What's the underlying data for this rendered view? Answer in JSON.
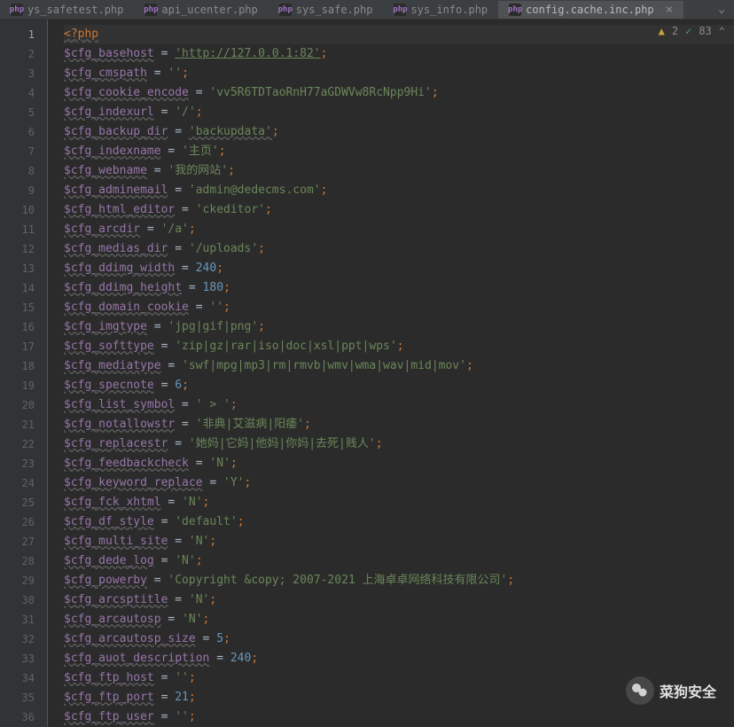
{
  "tabs": [
    {
      "label": "ys_safetest.php",
      "active": false
    },
    {
      "label": "api_ucenter.php",
      "active": false
    },
    {
      "label": "sys_safe.php",
      "active": false
    },
    {
      "label": "sys_info.php",
      "active": false
    },
    {
      "label": "config.cache.inc.php",
      "active": true
    }
  ],
  "status": {
    "warnings": "2",
    "checks": "83"
  },
  "watermark": "菜狗安全",
  "code": {
    "l1": {
      "t": "<?php"
    },
    "l2": {
      "v": "$cfg_basehost",
      "s": "'http://127.0.0.1:82'"
    },
    "l3": {
      "v": "$cfg_cmspath",
      "s": "''"
    },
    "l4": {
      "v": "$cfg_cookie_encode",
      "s": "'vv5R6TDTaoRnH77aGDWVw8RcNpp9Hi'"
    },
    "l5": {
      "v": "$cfg_indexurl",
      "s": "'/'"
    },
    "l6": {
      "v": "$cfg_backup_dir",
      "s": "'backupdata'"
    },
    "l7": {
      "v": "$cfg_indexname",
      "s": "'主页'"
    },
    "l8": {
      "v": "$cfg_webname",
      "s": "'我的网站'"
    },
    "l9": {
      "v": "$cfg_adminemail",
      "s": "'admin@dedecms.com'"
    },
    "l10": {
      "v": "$cfg_html_editor",
      "s": "'ckeditor'"
    },
    "l11": {
      "v": "$cfg_arcdir",
      "s": "'/a'"
    },
    "l12": {
      "v": "$cfg_medias_dir",
      "s": "'/uploads'"
    },
    "l13": {
      "v": "$cfg_ddimg_width",
      "n": "240"
    },
    "l14": {
      "v": "$cfg_ddimg_height",
      "n": "180"
    },
    "l15": {
      "v": "$cfg_domain_cookie",
      "s": "''"
    },
    "l16": {
      "v": "$cfg_imgtype",
      "s": "'jpg|gif|png'"
    },
    "l17": {
      "v": "$cfg_softtype",
      "s": "'zip|gz|rar|iso|doc|xsl|ppt|wps'"
    },
    "l18": {
      "v": "$cfg_mediatype",
      "s": "'swf|mpg|mp3|rm|rmvb|wmv|wma|wav|mid|mov'"
    },
    "l19": {
      "v": "$cfg_specnote",
      "n": "6"
    },
    "l20": {
      "v": "$cfg_list_symbol",
      "s": "' > '"
    },
    "l21": {
      "v": "$cfg_notallowstr",
      "s": "'非典|艾滋病|阳痿'"
    },
    "l22": {
      "v": "$cfg_replacestr",
      "s": "'她妈|它妈|他妈|你妈|去死|贱人'"
    },
    "l23": {
      "v": "$cfg_feedbackcheck",
      "s": "'N'"
    },
    "l24": {
      "v": "$cfg_keyword_replace",
      "s": "'Y'"
    },
    "l25": {
      "v": "$cfg_fck_xhtml",
      "s": "'N'"
    },
    "l26": {
      "v": "$cfg_df_style",
      "s": "'default'"
    },
    "l27": {
      "v": "$cfg_multi_site",
      "s": "'N'"
    },
    "l28": {
      "v": "$cfg_dede_log",
      "s": "'N'"
    },
    "l29": {
      "v": "$cfg_powerby",
      "s": "'Copyright &copy; 2007-2021 上海卓卓网络科技有限公司'"
    },
    "l30": {
      "v": "$cfg_arcsptitle",
      "s": "'N'"
    },
    "l31": {
      "v": "$cfg_arcautosp",
      "s": "'N'"
    },
    "l32": {
      "v": "$cfg_arcautosp_size",
      "n": "5"
    },
    "l33": {
      "v": "$cfg_auot_description",
      "n": "240"
    },
    "l34": {
      "v": "$cfg_ftp_host",
      "s": "''"
    },
    "l35": {
      "v": "$cfg_ftp_port",
      "n": "21"
    },
    "l36": {
      "v": "$cfg_ftp_user",
      "s": "''"
    }
  }
}
